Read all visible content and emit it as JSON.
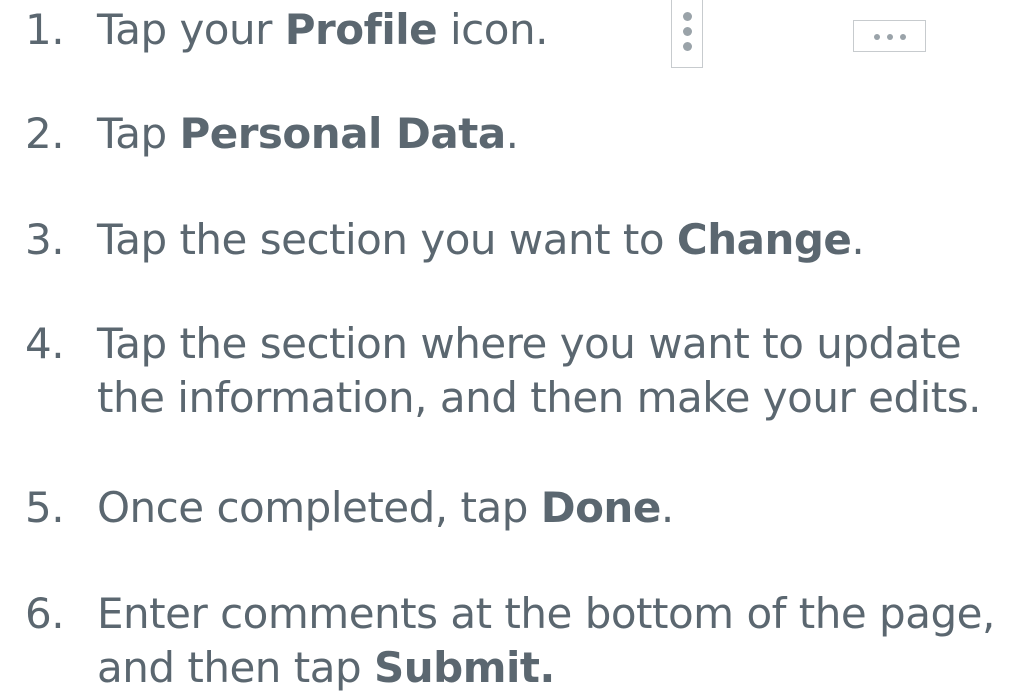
{
  "steps": [
    {
      "number": "1.",
      "pre": "Tap your ",
      "bold": "Profile",
      "post": " icon."
    },
    {
      "number": "2.",
      "pre": "Tap ",
      "bold": "Personal Data",
      "post": "."
    },
    {
      "number": "3.",
      "pre": "Tap the section you want to ",
      "bold": "Change",
      "post": "."
    },
    {
      "number": "4.",
      "line1": "Tap the section where you want to update",
      "line2": "the information, and then make your edits."
    },
    {
      "number": "5.",
      "pre": "Once completed, tap ",
      "bold": "Done",
      "post": "."
    },
    {
      "number": "6.",
      "line1": "Enter comments at the bottom of the page,",
      "line2_pre": "and then tap ",
      "line2_bold": "Submit."
    }
  ],
  "icons": {
    "vertical": "more-vertical-icon",
    "horizontal": "more-horizontal-icon"
  },
  "colors": {
    "text": "#5b6770",
    "icon": "#9aa3a9",
    "icon_border": "#c7cbce"
  }
}
